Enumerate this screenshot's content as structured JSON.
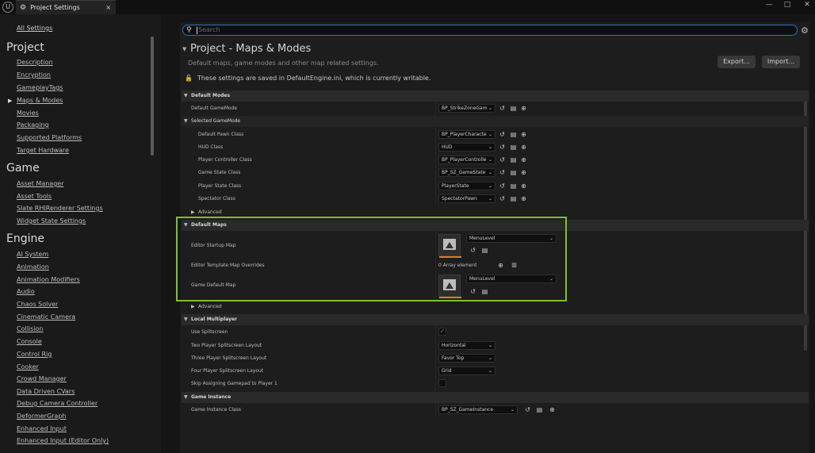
{
  "window": {
    "logo_icon": "unreal-logo-icon",
    "tab_label": "Project Settings",
    "tab_close": "×",
    "minimize": "—",
    "maximize": "□",
    "close": "✕"
  },
  "sidebar": {
    "all_settings": "All Settings",
    "sections": [
      {
        "title": "Project",
        "items": [
          "Description",
          "Encryption",
          "GameplayTags",
          "Maps & Modes",
          "Movies",
          "Packaging",
          "Supported Platforms",
          "Target Hardware"
        ]
      },
      {
        "title": "Game",
        "items": [
          "Asset Manager",
          "Asset Tools",
          "Slate RHIRenderer Settings",
          "Widget State Settings"
        ]
      },
      {
        "title": "Engine",
        "items": [
          "AI System",
          "Animation",
          "Animation Modifiers",
          "Audio",
          "Chaos Solver",
          "Cinematic Camera",
          "Collision",
          "Console",
          "Control Rig",
          "Cooker",
          "Crowd Manager",
          "Data Driven CVars",
          "Debug Camera Controller",
          "DeformerGraph",
          "Enhanced Input",
          "Enhanced Input (Editor Only)"
        ]
      }
    ],
    "selected": "Maps & Modes"
  },
  "search": {
    "placeholder": "Search"
  },
  "header": {
    "title": "Project - Maps & Modes",
    "subtitle": "Default maps, game modes and other map related settings.",
    "export_label": "Export...",
    "import_label": "Import...",
    "save_note": "These settings are saved in DefaultEngine.ini, which is currently writable."
  },
  "default_modes": {
    "header": "Default Modes",
    "default_gamemode_label": "Default GameMode",
    "default_gamemode_value": "BP_StrikeZoneGam",
    "selected_gamemode_header": "Selected GameMode",
    "rows": [
      {
        "label": "Default Pawn Class",
        "value": "BP_PlayerCharacte"
      },
      {
        "label": "HUD Class",
        "value": "HUD"
      },
      {
        "label": "Player Controller Class",
        "value": "BP_PlayerControlle"
      },
      {
        "label": "Game State Class",
        "value": "BP_SZ_GameState"
      },
      {
        "label": "Player State Class",
        "value": "PlayerState"
      },
      {
        "label": "Spectator Class",
        "value": "SpectatorPawn"
      }
    ],
    "advanced": "Advanced"
  },
  "default_maps": {
    "header": "Default Maps",
    "editor_startup_label": "Editor Startup Map",
    "editor_startup_value": "MenuLevel",
    "template_overrides_label": "Editor Template Map Overrides",
    "template_overrides_value": "0 Array element",
    "game_default_label": "Game Default Map",
    "game_default_value": "MenuLevel",
    "advanced": "Advanced"
  },
  "local_multiplayer": {
    "header": "Local Multiplayer",
    "use_splitscreen_label": "Use Splitscreen",
    "use_splitscreen_checked": true,
    "two_player_label": "Two Player Splitscreen Layout",
    "two_player_value": "Horizontal",
    "three_player_label": "Three Player Splitscreen Layout",
    "three_player_value": "Favor Top",
    "four_player_label": "Four Player Splitscreen Layout",
    "four_player_value": "Grid",
    "skip_gamepad_label": "Skip Assigning Gamepad to Player 1",
    "skip_gamepad_checked": false
  },
  "game_instance": {
    "header": "Game Instance",
    "class_label": "Game Instance Class",
    "class_value": "BP_SZ_GameInstance"
  },
  "icons": {
    "browse": "⦿",
    "folder": "▤",
    "add": "⊕",
    "back": "↺",
    "trash": "🗑",
    "search": "⚲",
    "gear": "⚙",
    "lock": "🔓",
    "check": "✓"
  }
}
